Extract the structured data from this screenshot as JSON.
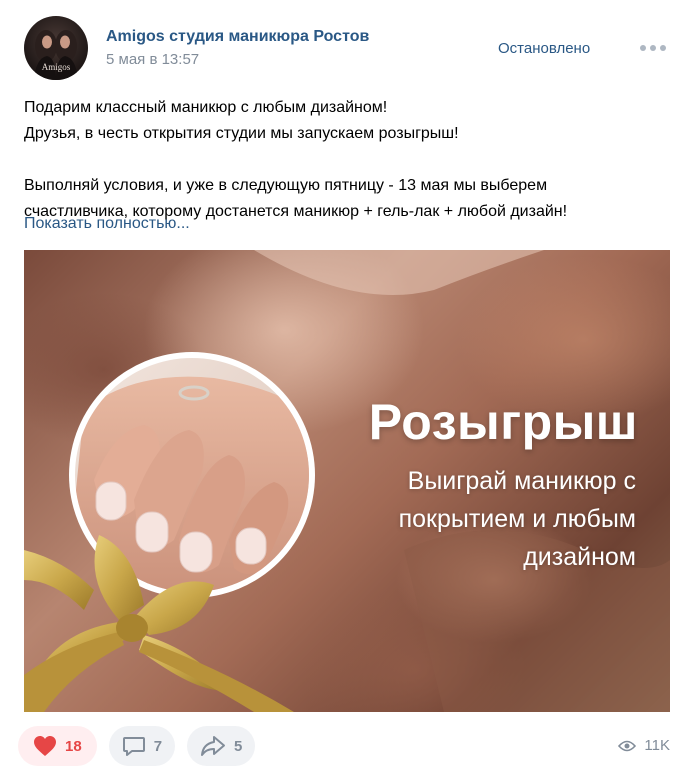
{
  "header": {
    "group_name": "Amigos студия маникюра Ростов",
    "date": "5 мая в 13:57",
    "pinned_label": "Остановлено",
    "avatar_text": "Amigos"
  },
  "post": {
    "lines": [
      "Подарим классный маникюр с любым дизайном!",
      "Друзья, в честь открытия студии мы запускаем розыгрыш!",
      "",
      "Выполняй условия, и уже в следующую пятницу - 13 мая мы выберем",
      "счастливчика, которому достанется маникюр + гель-лак + любой дизайн!"
    ],
    "show_more": "Показать полностью..."
  },
  "image": {
    "title": "Розыгрыш",
    "subtitle": "Выиграй маникюр с покрытием и любым дизайном"
  },
  "footer": {
    "likes": "18",
    "comments": "7",
    "reposts": "5",
    "views": "11K"
  },
  "colors": {
    "link": "#2a5885",
    "like_red": "#e64646",
    "secondary": "#818c99",
    "bow_gold": "#c9a74a"
  }
}
